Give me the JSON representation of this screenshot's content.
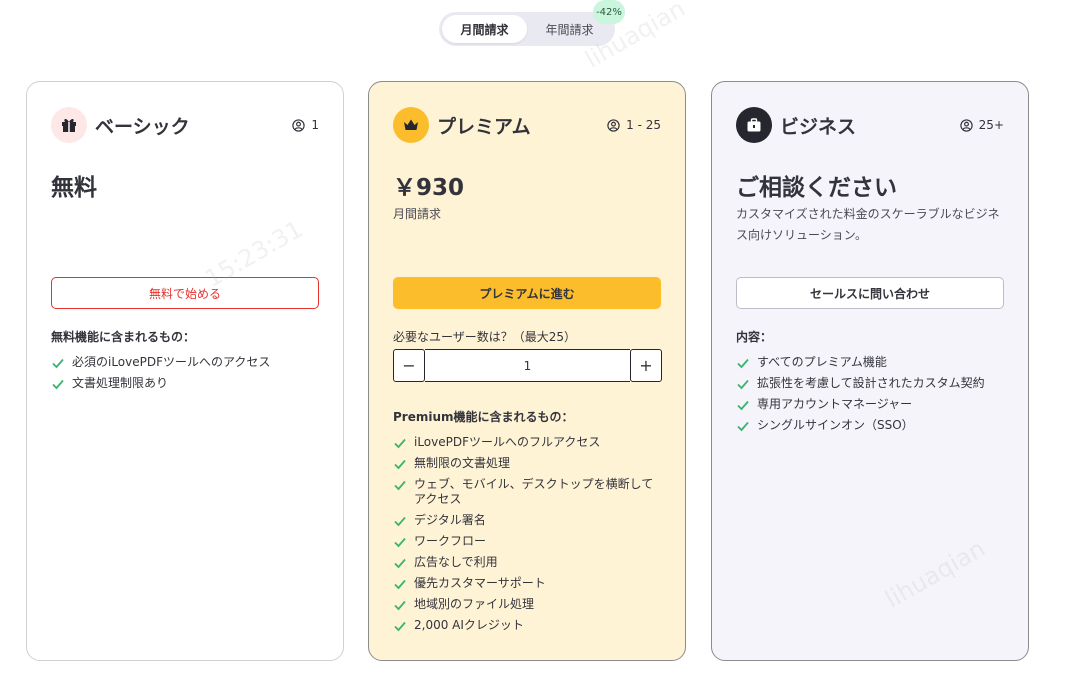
{
  "billing_toggle": {
    "monthly_label": "月間請求",
    "yearly_label": "年間請求",
    "discount_badge": "-42%"
  },
  "plans": {
    "basic": {
      "name": "ベーシック",
      "users": "1",
      "price": "無料",
      "cta": "無料で始める",
      "features_title": "無料機能に含まれるもの：",
      "features": [
        "必須のiLovePDFツールへのアクセス",
        "文書処理制限あり"
      ]
    },
    "premium": {
      "name": "プレミアム",
      "users": "1 - 25",
      "price": "￥930",
      "price_sub": "月間請求",
      "cta": "プレミアムに進む",
      "stepper_label": "必要なユーザー数は？（最大25）",
      "stepper_minus": "−",
      "stepper_plus": "+",
      "stepper_value": "1",
      "features_title": "Premium機能に含まれるもの：",
      "features": [
        "iLovePDFツールへのフルアクセス",
        "無制限の文書処理",
        "ウェブ、モバイル、デスクトップを横断してアクセス",
        "デジタル署名",
        "ワークフロー",
        "広告なしで利用",
        "優先カスタマーサポート",
        "地域別のファイル処理",
        "2,000 AIクレジット"
      ]
    },
    "business": {
      "name": "ビジネス",
      "users": "25+",
      "price": "ご相談ください",
      "price_sub": "カスタマイズされた料金のスケーラブルなビジネス向けソリューション。",
      "cta": "セールスに問い合わせ",
      "features_title": "内容：",
      "features": [
        "すべてのプレミアム機能",
        "拡張性を考慮して設計されたカスタム契約",
        "専用アカウントマネージャー",
        "シングルサインオン（SSO）"
      ]
    }
  },
  "watermark": [
    "lihuaqian",
    "15:23:31"
  ],
  "colors": {
    "accent_red": "#e5322d",
    "premium_yellow": "#fbbd2b",
    "premium_bg": "#fff3d6",
    "business_bg": "#f4f4fa",
    "check_green": "#3cb371"
  }
}
